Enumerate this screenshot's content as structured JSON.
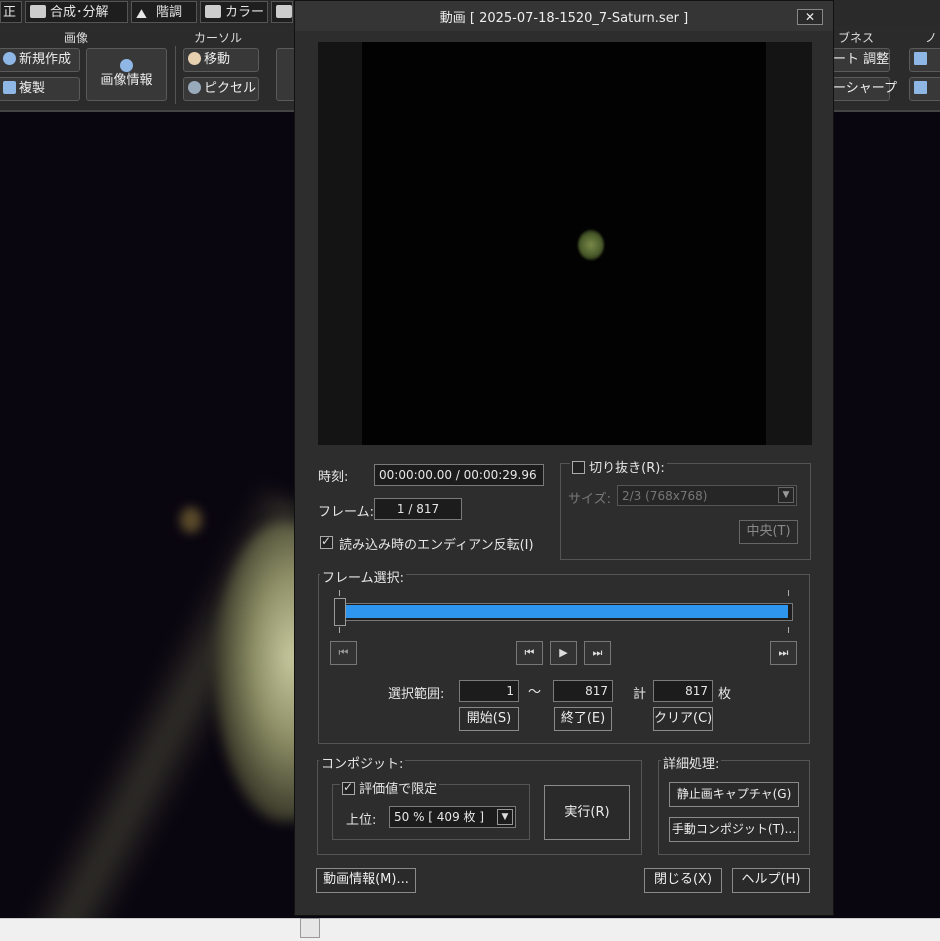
{
  "background_app": {
    "tabs": [
      {
        "label": "正"
      },
      {
        "label": "合成･分解"
      },
      {
        "label": "階調"
      },
      {
        "label": "カラー"
      }
    ],
    "ribbon": {
      "group_image": "画像",
      "group_cursor": "カーソル",
      "group_right": "ブネス",
      "group_far_right": "ノ",
      "new_label": "新規作成",
      "duplicate_label": "複製",
      "image_info_label": "画像情報",
      "move_label": "移動",
      "pixel_label": "ピクセル",
      "adjust_label": "ート 調整",
      "sharp_label": "ーシャープ"
    }
  },
  "dialog": {
    "title": "動画 [ 2025-07-18-1520_7-Saturn.ser ]",
    "close_glyph": "✕",
    "time_label": "時刻:",
    "time_value": "00:00:00.00 / 00:00:29.96",
    "frame_label": "フレーム:",
    "frame_value": "1 / 817",
    "endian_label": "読み込み時のエンディアン反転(I)",
    "endian_checked": true,
    "crop": {
      "title": "切り抜き(R):",
      "checked": false,
      "size_label": "サイズ:",
      "size_value": "2/3 (768x768)",
      "center_button": "中央(T)"
    },
    "frame_select": {
      "title": "フレーム選択:",
      "range_label": "選択範囲:",
      "range_start": "1",
      "range_sep": "〜",
      "range_end": "817",
      "total_label": "計",
      "total_value": "817",
      "unit": "枚",
      "start_button": "開始(S)",
      "end_button": "終了(E)",
      "clear_button": "クリア(C)",
      "selected_fraction": 1.0
    },
    "composite": {
      "title": "コンポジット:",
      "eval_label": "評価値で限定",
      "eval_checked": true,
      "top_label": "上位:",
      "top_value": "50 % [ 409 枚 ]",
      "run_button": "実行(R)"
    },
    "detail": {
      "title": "詳細処理:",
      "capture_button": "静止画キャプチャ(G)",
      "manual_button": "手動コンポジット(T)..."
    },
    "video_info_button": "動画情報(M)...",
    "close_button": "閉じる(X)",
    "help_button": "ヘルプ(H)",
    "colors": {
      "accent": "#2f96f0",
      "dialog_bg": "#2d2d2d"
    }
  }
}
